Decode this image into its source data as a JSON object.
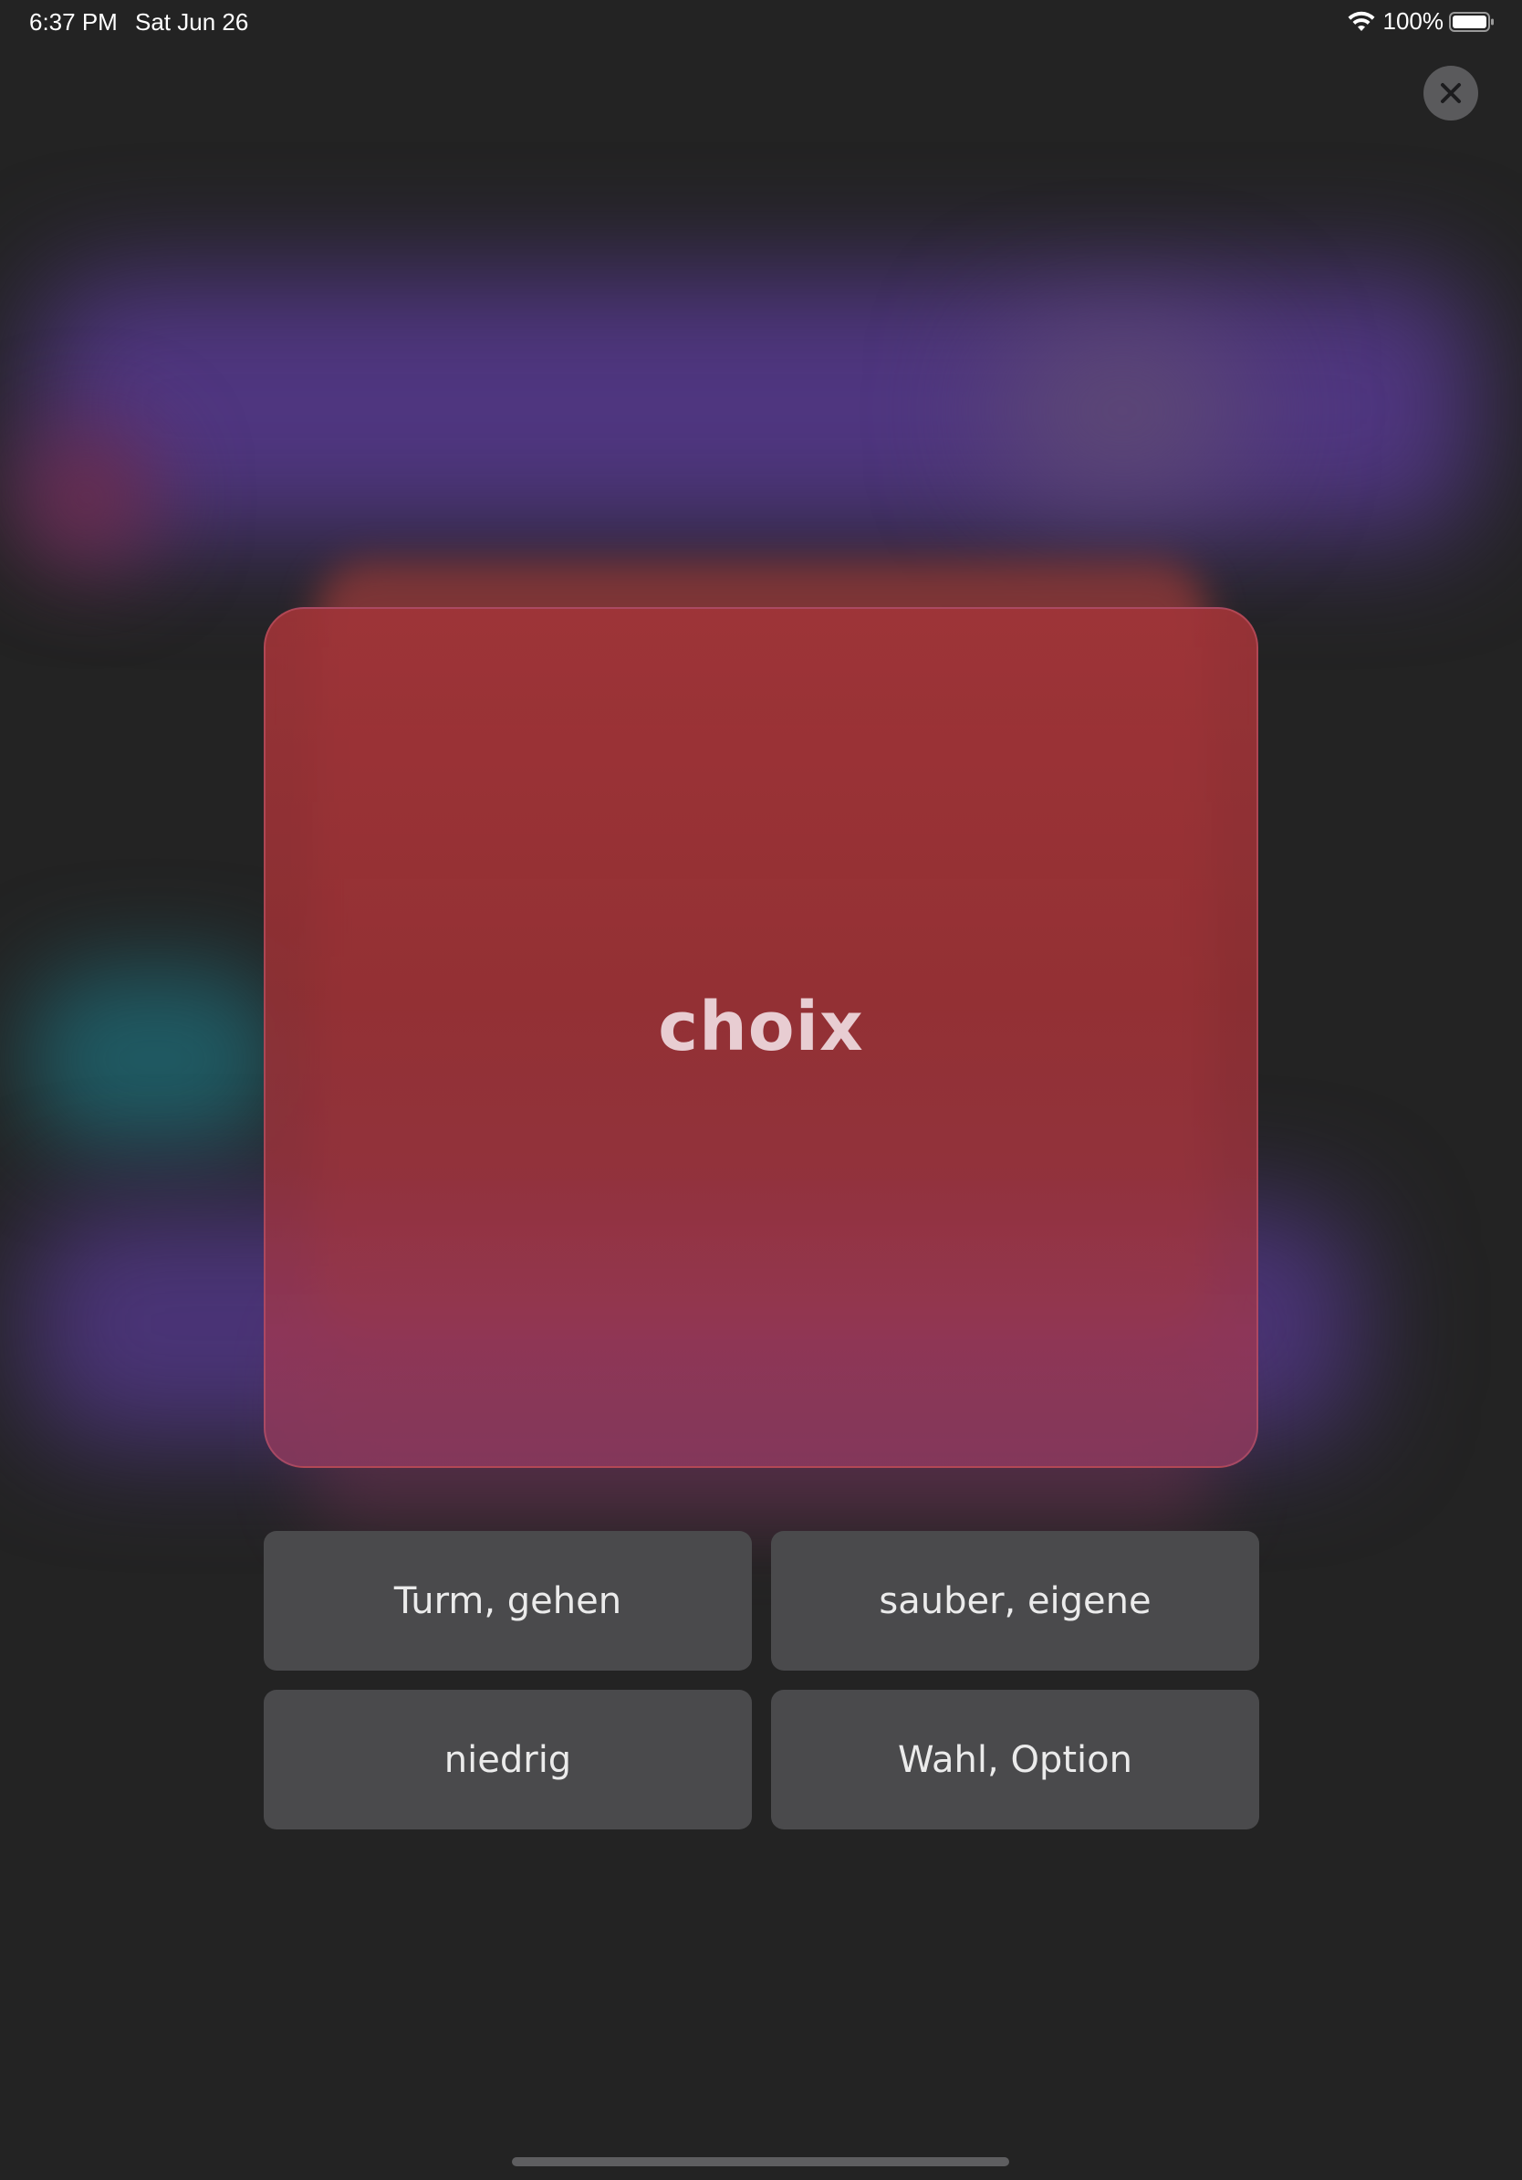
{
  "status_bar": {
    "time": "6:37 PM",
    "date": "Sat Jun 26",
    "battery_percent": "100%",
    "wifi_icon": "wifi-icon",
    "battery_icon": "battery-icon"
  },
  "close_button": {
    "icon": "close-icon"
  },
  "flashcard": {
    "word": "choix",
    "color": "#9a3438"
  },
  "answers": [
    {
      "label": "Turm, gehen"
    },
    {
      "label": "sauber, eigene"
    },
    {
      "label": "niedrig"
    },
    {
      "label": "Wahl, Option"
    }
  ],
  "colors": {
    "background": "#232323",
    "answer_button": "#4a4a4c",
    "card_text": "#e8cdd2"
  }
}
